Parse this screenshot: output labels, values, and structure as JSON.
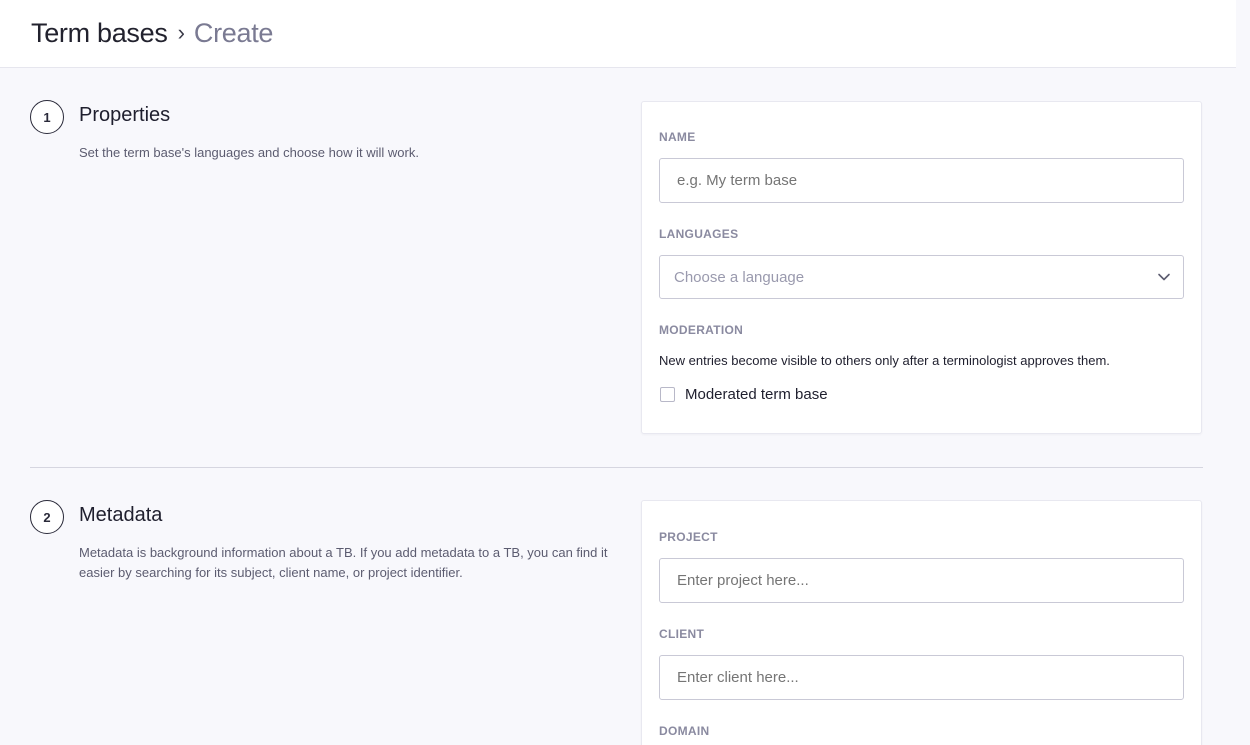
{
  "breadcrumb": {
    "root": "Term bases",
    "separator": "›",
    "current": "Create"
  },
  "sections": [
    {
      "number": "1",
      "title": "Properties",
      "description": "Set the term base's languages and choose how it will work."
    },
    {
      "number": "2",
      "title": "Metadata",
      "description_line1": "Metadata is background information about a TB. If you add metadata to a TB, you can find it",
      "description_line2": "easier by searching for its subject, client name, or project identifier."
    }
  ],
  "properties": {
    "name_label": "NAME",
    "name_placeholder": "e.g. My term base",
    "languages_label": "LANGUAGES",
    "languages_value": "Choose a language",
    "moderation_label": "MODERATION",
    "moderation_note": "New entries become visible to others only after a terminologist approves them.",
    "moderated_label": "Moderated term base",
    "moderated_checked": false
  },
  "metadata": {
    "project_label": "PROJECT",
    "project_placeholder": "Enter project here...",
    "client_label": "CLIENT",
    "client_placeholder": "Enter client here...",
    "domain_label": "DOMAIN"
  },
  "icons": {
    "dropdown": "chevron-down-icon"
  }
}
